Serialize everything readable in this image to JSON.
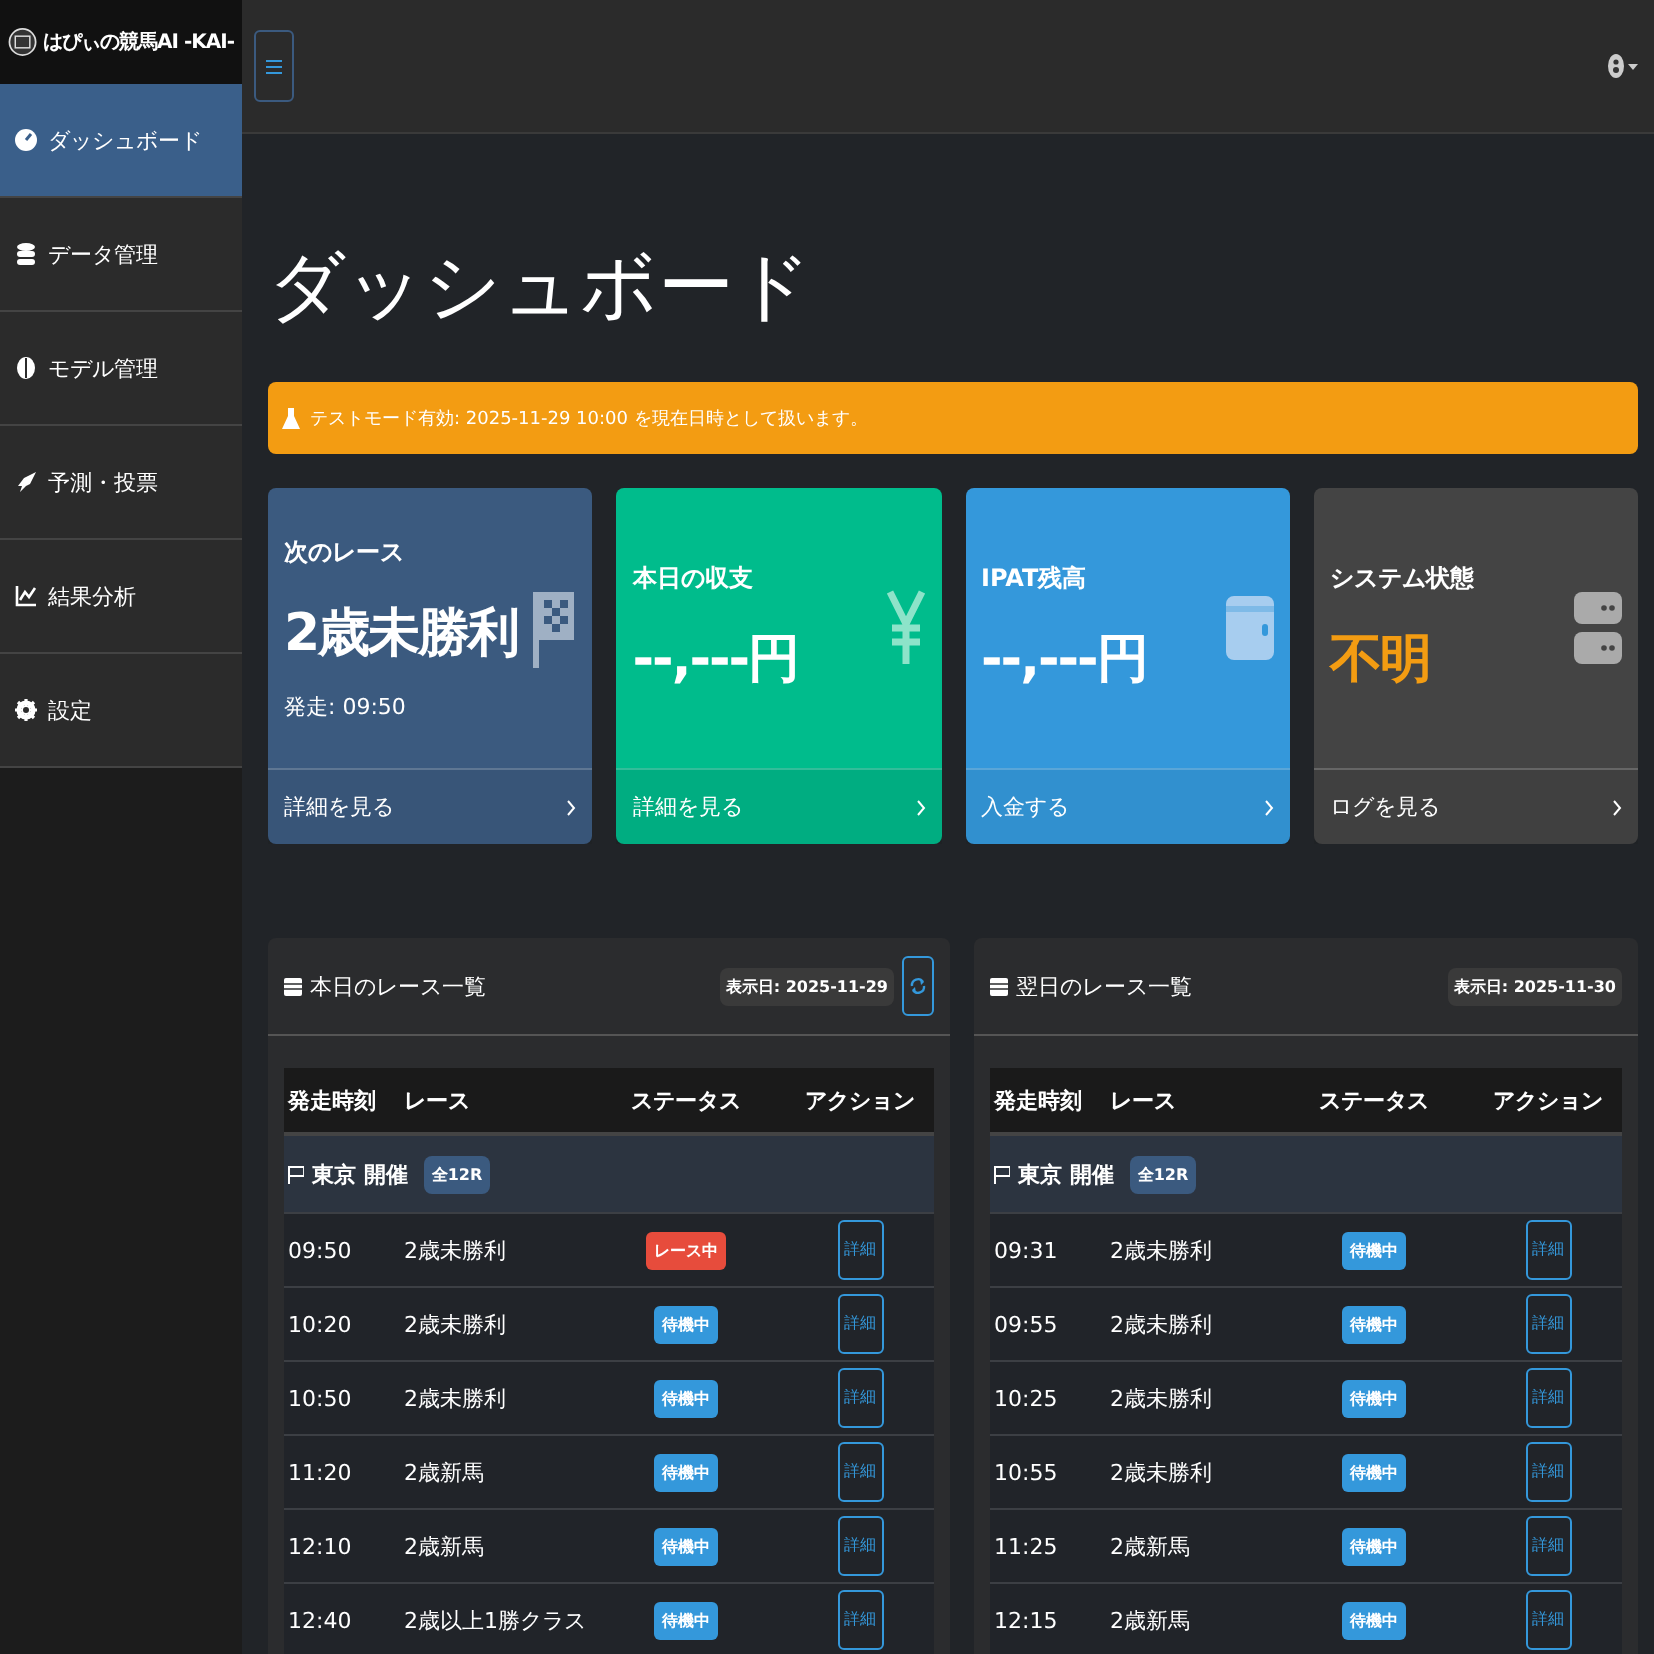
{
  "sidebar": {
    "logo": "はぴぃの競馬AI -KAI-",
    "items": [
      {
        "label": "ダッシュボード",
        "selected": true
      },
      {
        "label": "データ管理",
        "selected": false
      },
      {
        "label": "モデル管理",
        "selected": false
      },
      {
        "label": "予測・投票",
        "selected": false
      },
      {
        "label": "結果分析",
        "selected": false
      },
      {
        "label": "設定",
        "selected": false
      }
    ]
  },
  "page_title": "ダッシュボード",
  "alert": {
    "text": "テストモード有効: 2025-11-29 10:00 を現在日時として扱います。"
  },
  "cards": [
    {
      "kind": "race",
      "title": "次のレース",
      "value": "2歳未勝利",
      "sub": "発走: 09:50",
      "footer": "詳細を見る"
    },
    {
      "kind": "balance",
      "title": "本日の収支",
      "value": "--,---円",
      "footer": "詳細を見る"
    },
    {
      "kind": "ipat",
      "title": "IPAT残高",
      "value": "--,---円",
      "footer": "入金する"
    },
    {
      "kind": "system",
      "title": "システム状態",
      "value": "不明",
      "footer": "ログを見る"
    }
  ],
  "panels": [
    {
      "title": "本日のレース一覧",
      "date_badge": "表示日: 2025-11-29",
      "refresh": true,
      "columns": [
        "発走時刻",
        "レース",
        "ステータス",
        "アクション"
      ],
      "groups": [
        {
          "venue": "東京 開催",
          "count": "全12R",
          "rows": [
            {
              "time": "09:50",
              "race": "2歳未勝利",
              "status": {
                "label": "レース中",
                "kind": "running"
              },
              "action": "詳細"
            },
            {
              "time": "10:20",
              "race": "2歳未勝利",
              "status": {
                "label": "待機中",
                "kind": "waiting"
              },
              "action": "詳細"
            },
            {
              "time": "10:50",
              "race": "2歳未勝利",
              "status": {
                "label": "待機中",
                "kind": "waiting"
              },
              "action": "詳細"
            },
            {
              "time": "11:20",
              "race": "2歳新馬",
              "status": {
                "label": "待機中",
                "kind": "waiting"
              },
              "action": "詳細"
            },
            {
              "time": "12:10",
              "race": "2歳新馬",
              "status": {
                "label": "待機中",
                "kind": "waiting"
              },
              "action": "詳細"
            },
            {
              "time": "12:40",
              "race": "2歳以上1勝クラス",
              "status": {
                "label": "待機中",
                "kind": "waiting"
              },
              "action": "詳細"
            }
          ]
        }
      ]
    },
    {
      "title": "翌日のレース一覧",
      "date_badge": "表示日: 2025-11-30",
      "refresh": false,
      "columns": [
        "発走時刻",
        "レース",
        "ステータス",
        "アクション"
      ],
      "groups": [
        {
          "venue": "東京 開催",
          "count": "全12R",
          "rows": [
            {
              "time": "09:31",
              "race": "2歳未勝利",
              "status": {
                "label": "待機中",
                "kind": "waiting"
              },
              "action": "詳細"
            },
            {
              "time": "09:55",
              "race": "2歳未勝利",
              "status": {
                "label": "待機中",
                "kind": "waiting"
              },
              "action": "詳細"
            },
            {
              "time": "10:25",
              "race": "2歳未勝利",
              "status": {
                "label": "待機中",
                "kind": "waiting"
              },
              "action": "詳細"
            },
            {
              "time": "10:55",
              "race": "2歳未勝利",
              "status": {
                "label": "待機中",
                "kind": "waiting"
              },
              "action": "詳細"
            },
            {
              "time": "11:25",
              "race": "2歳新馬",
              "status": {
                "label": "待機中",
                "kind": "waiting"
              },
              "action": "詳細"
            },
            {
              "time": "12:15",
              "race": "2歳新馬",
              "status": {
                "label": "待機中",
                "kind": "waiting"
              },
              "action": "詳細"
            }
          ]
        }
      ]
    }
  ]
}
